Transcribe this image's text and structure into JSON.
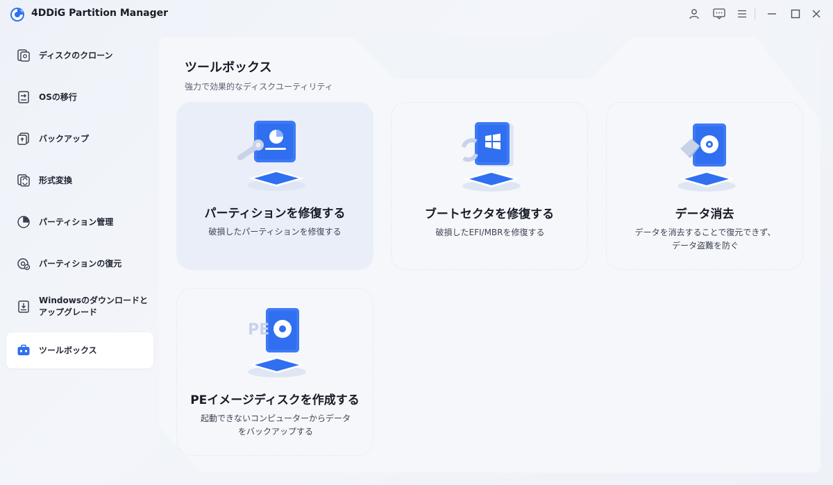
{
  "app": {
    "title": "4DDiG Partition Manager"
  },
  "titlebar": {
    "icons": [
      "user-icon",
      "feedback-icon",
      "menu-icon"
    ],
    "window_controls": [
      "minimize-icon",
      "maximize-icon",
      "close-icon"
    ]
  },
  "sidebar": {
    "items": [
      {
        "label": "ディスクのクローン",
        "icon": "disk-clone-icon",
        "active": false
      },
      {
        "label": "OSの移行",
        "icon": "os-migrate-icon",
        "active": false
      },
      {
        "label": "バックアップ",
        "icon": "backup-icon",
        "active": false
      },
      {
        "label": "形式変換",
        "icon": "convert-icon",
        "active": false
      },
      {
        "label": "パーティション管理",
        "icon": "partition-pie-icon",
        "active": false
      },
      {
        "label": "パーティションの復元",
        "icon": "partition-recover-icon",
        "active": false
      },
      {
        "label": "Windowsのダウンロードと",
        "label2": "アップグレード",
        "icon": "windows-download-icon",
        "active": false
      },
      {
        "label": "ツールボックス",
        "icon": "toolbox-icon",
        "active": true
      }
    ]
  },
  "main": {
    "title": "ツールボックス",
    "subtitle": "強力で効果的なディスクユーティリティ",
    "cards": [
      {
        "title": "パーティションを修復する",
        "desc": "破損したパーティションを修復する",
        "desc2": "",
        "icon": "partition-repair-icon"
      },
      {
        "title": "ブートセクタを修復する",
        "desc": "破損したEFI/MBRを修復する",
        "desc2": "",
        "icon": "boot-repair-icon"
      },
      {
        "title": "データ消去",
        "desc": "データを消去することで復元できず、",
        "desc2": "データ盗難を防ぐ",
        "icon": "data-erase-icon"
      },
      {
        "title": "PEイメージディスクを作成する",
        "desc": "起動できないコンピューターからデータ",
        "desc2": "をバックアップする",
        "icon": "pe-image-icon"
      }
    ]
  },
  "colors": {
    "accent": "#2f6ff0",
    "accent_dark": "#1f52d6",
    "active_bg": "#ffffff",
    "card_hover_bg": "#e9eef8"
  }
}
